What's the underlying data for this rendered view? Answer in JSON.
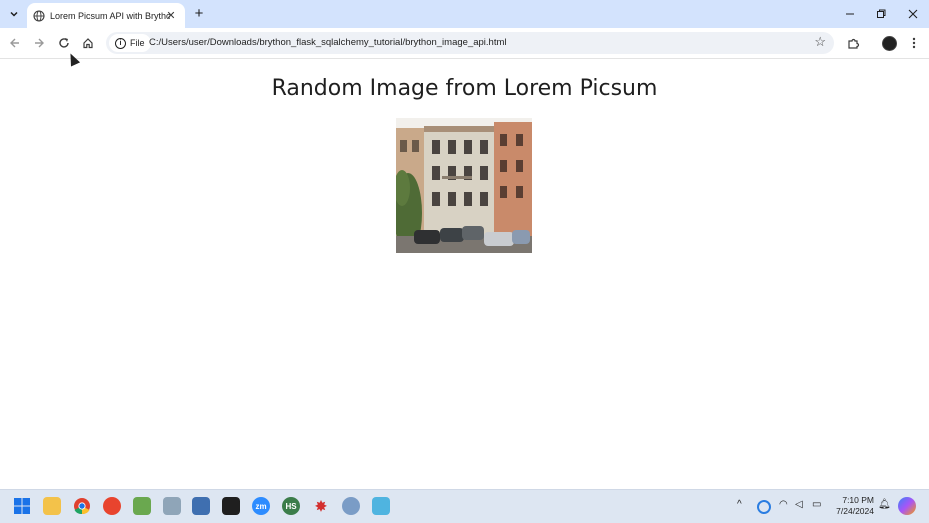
{
  "browser": {
    "tab_title": "Lorem Picsum API with Brython",
    "url_chip": "File",
    "url": "C:/Users/user/Downloads/brython_flask_sqlalchemy_tutorial/brython_image_api.html"
  },
  "page": {
    "heading": "Random Image from Lorem Picsum"
  },
  "taskbar": {
    "time": "7:10 PM",
    "date": "7/24/2024"
  }
}
